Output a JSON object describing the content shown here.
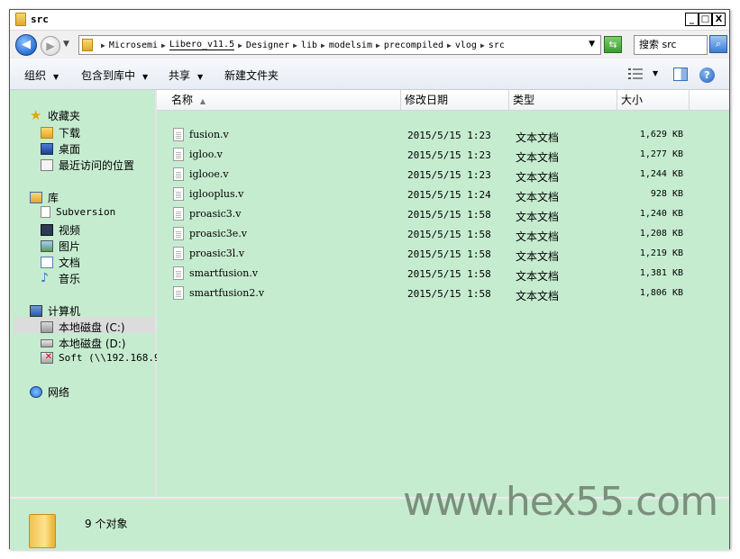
{
  "window": {
    "title": "src",
    "controls": {
      "minimize": "_",
      "maximize": "□",
      "close": "X"
    }
  },
  "address": {
    "crumbs": [
      "Microsemi",
      "Libero_v11.5",
      "Designer",
      "lib",
      "modelsim",
      "precompiled",
      "vlog",
      "src"
    ],
    "search_placeholder": "搜索 src"
  },
  "toolbar": {
    "organize": "组织",
    "include_in_library": "包含到库中",
    "share": "共享",
    "new_folder": "新建文件夹"
  },
  "nav": {
    "favorites": {
      "label": "收藏夹",
      "items": [
        {
          "label": "下载",
          "icon": "download-folder-icon"
        },
        {
          "label": "桌面",
          "icon": "desktop-icon"
        },
        {
          "label": "最近访问的位置",
          "icon": "recent-places-icon"
        }
      ]
    },
    "libraries": {
      "label": "库",
      "items": [
        {
          "label": "Subversion",
          "icon": "library-doc-icon"
        },
        {
          "label": "视频",
          "icon": "video-icon"
        },
        {
          "label": "图片",
          "icon": "pictures-icon"
        },
        {
          "label": "文档",
          "icon": "documents-icon"
        },
        {
          "label": "音乐",
          "icon": "music-icon"
        }
      ]
    },
    "computer": {
      "label": "计算机",
      "items": [
        {
          "label": "本地磁盘 (C:)",
          "icon": "drive-c-icon"
        },
        {
          "label": "本地磁盘 (D:)",
          "icon": "drive-d-icon"
        },
        {
          "label": "Soft (\\\\192.168.9.",
          "icon": "network-drive-disconnected-icon"
        }
      ]
    },
    "network": {
      "label": "网络"
    }
  },
  "columns": {
    "name": "名称",
    "modified": "修改日期",
    "type": "类型",
    "size": "大小"
  },
  "files": [
    {
      "name": "fusion.v",
      "modified": "2015/5/15 1:23",
      "type": "文本文档",
      "size": "1,629 KB"
    },
    {
      "name": "igloo.v",
      "modified": "2015/5/15 1:23",
      "type": "文本文档",
      "size": "1,277 KB"
    },
    {
      "name": "iglooe.v",
      "modified": "2015/5/15 1:23",
      "type": "文本文档",
      "size": "1,244 KB"
    },
    {
      "name": "iglooplus.v",
      "modified": "2015/5/15 1:24",
      "type": "文本文档",
      "size": "928 KB"
    },
    {
      "name": "proasic3.v",
      "modified": "2015/5/15 1:58",
      "type": "文本文档",
      "size": "1,240 KB"
    },
    {
      "name": "proasic3e.v",
      "modified": "2015/5/15 1:58",
      "type": "文本文档",
      "size": "1,208 KB"
    },
    {
      "name": "proasic3l.v",
      "modified": "2015/5/15 1:58",
      "type": "文本文档",
      "size": "1,219 KB"
    },
    {
      "name": "smartfusion.v",
      "modified": "2015/5/15 1:58",
      "type": "文本文档",
      "size": "1,381 KB"
    },
    {
      "name": "smartfusion2.v",
      "modified": "2015/5/15 1:58",
      "type": "文本文档",
      "size": "1,806 KB"
    }
  ],
  "status": {
    "count": "9 个对象"
  },
  "watermark": "www.hex55.com",
  "colors": {
    "pane_background": "#c6ecd0",
    "accent_blue": "#2a6fd6"
  }
}
